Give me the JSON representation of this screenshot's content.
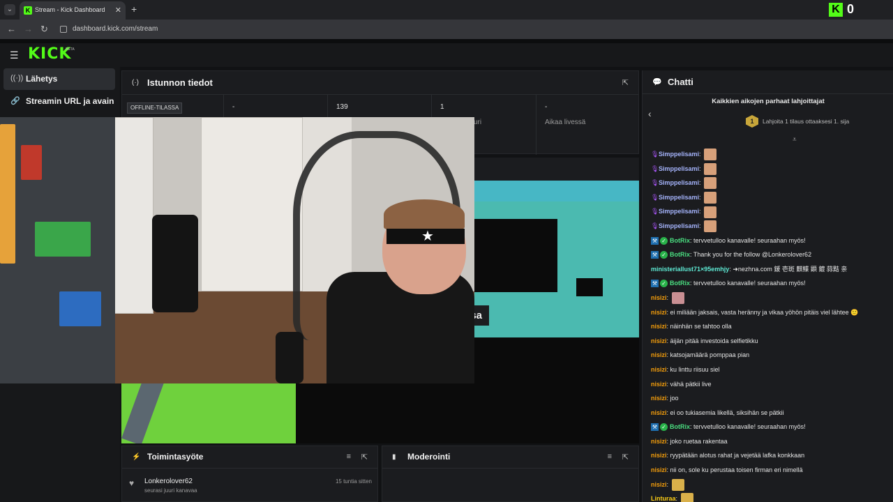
{
  "browser": {
    "tab_menu_icon": "chevron-down-icon",
    "tab_title": "Stream - Kick Dashboard",
    "tab_close": "✕",
    "new_tab": "+",
    "url": "dashboard.kick.com/stream",
    "kick_count": "0"
  },
  "header": {
    "logo": "KICK",
    "beta": "BETA"
  },
  "sidebar": {
    "items": [
      {
        "label": "Lähetys",
        "icon": "broadcast-icon",
        "active": true
      },
      {
        "label": "Streamin URL ja avain",
        "icon": "link-icon",
        "active": false
      }
    ]
  },
  "session": {
    "title": "Istunnon tiedot",
    "stats": [
      {
        "value": "OFFLINE-TILASSA",
        "label": ""
      },
      {
        "value": "-",
        "label": ""
      },
      {
        "value": "139",
        "label": ""
      },
      {
        "value": "1",
        "label": "uri"
      },
      {
        "value": "-",
        "label": "Aikaa livessä"
      }
    ]
  },
  "preview": {
    "label": "ssa"
  },
  "activity": {
    "title": "Toimintasyöte",
    "items": [
      {
        "user": "Lonkerolover62",
        "text": "seurasi juuri kanavaa",
        "time": "15 tuntia sitten"
      }
    ]
  },
  "moderation": {
    "title": "Moderointi"
  },
  "chat": {
    "title": "Chatti",
    "gifters_title": "Kaikkien aikojen parhaat lahjoittajat",
    "gifters_rank": "1",
    "gifters_text": "Lahjoita 1 tilaus ottaaksesi 1. sija",
    "colors": {
      "purple": "#a78bfa",
      "green": "#4ade80",
      "teal": "#5eead4",
      "orange": "#f59e0b",
      "gold": "#facc15"
    },
    "messages": [
      {
        "badge": "mic",
        "user": "Simppelisami",
        "color": "#a5b4fc",
        "text": "",
        "emote": "face"
      },
      {
        "badge": "mic",
        "user": "Simppelisami",
        "color": "#a5b4fc",
        "text": "",
        "emote": "face"
      },
      {
        "badge": "mic",
        "user": "Simppelisami",
        "color": "#a5b4fc",
        "text": "",
        "emote": "face"
      },
      {
        "badge": "mic",
        "user": "Simppelisami",
        "color": "#a5b4fc",
        "text": "",
        "emote": "face"
      },
      {
        "badge": "mic",
        "user": "Simppelisami",
        "color": "#a5b4fc",
        "text": "",
        "emote": "face"
      },
      {
        "badge": "mic",
        "user": "Simppelisami",
        "color": "#a5b4fc",
        "text": "",
        "emote": "face"
      },
      {
        "badge": "bot",
        "user": "BotRix",
        "color": "#4ade80",
        "text": "tervvetulloo kanavalle! seuraahan myös!",
        "emote": ""
      },
      {
        "badge": "bot",
        "user": "BotRix",
        "color": "#4ade80",
        "text": "Thank you for the follow @Lonkerolover62",
        "emote": ""
      },
      {
        "badge": "",
        "user": "ministeriallust71×95emhjy",
        "color": "#5eead4",
        "text": "➜nezhna.com 鍰 壱斑 麒鰈 顕 鍍 蒜黠 亲",
        "emote": ""
      },
      {
        "badge": "bot",
        "user": "BotRix",
        "color": "#4ade80",
        "text": "tervvetulloo kanavalle! seuraahan myös!",
        "emote": ""
      },
      {
        "badge": "",
        "user": "nisizi",
        "color": "#f59e0b",
        "text": "",
        "emote": "pink"
      },
      {
        "badge": "",
        "user": "nisizi",
        "color": "#f59e0b",
        "text": "ei miliään jaksais, vasta herännу ja vikaa yöhön pitäis viel lähtee 🙂",
        "emote": ""
      },
      {
        "badge": "",
        "user": "nisizi",
        "color": "#f59e0b",
        "text": "näinhän se tahtoo olla",
        "emote": ""
      },
      {
        "badge": "",
        "user": "nisizi",
        "color": "#f59e0b",
        "text": "äijän pitää investoida selfietikku",
        "emote": ""
      },
      {
        "badge": "",
        "user": "nisizi",
        "color": "#f59e0b",
        "text": "katsojamäärä pomppaa pian",
        "emote": ""
      },
      {
        "badge": "",
        "user": "nisizi",
        "color": "#f59e0b",
        "text": "ku linttu riisuu siel",
        "emote": ""
      },
      {
        "badge": "",
        "user": "nisizi",
        "color": "#f59e0b",
        "text": "vähä pätkii live",
        "emote": ""
      },
      {
        "badge": "",
        "user": "nisizi",
        "color": "#f59e0b",
        "text": "joo",
        "emote": ""
      },
      {
        "badge": "",
        "user": "nisizi",
        "color": "#f59e0b",
        "text": "ei oo tukiasemia likellä, siksihän se pätkii",
        "emote": ""
      },
      {
        "badge": "bot",
        "user": "BotRix",
        "color": "#4ade80",
        "text": "tervvetulloo kanavalle! seuraahan myös!",
        "emote": ""
      },
      {
        "badge": "",
        "user": "nisizi",
        "color": "#f59e0b",
        "text": "joko ruetaa rakentaa",
        "emote": ""
      },
      {
        "badge": "",
        "user": "nisizi",
        "color": "#f59e0b",
        "text": "ryypätään alotus rahat ja vejetää lafka konkkaan",
        "emote": ""
      },
      {
        "badge": "",
        "user": "nisizi",
        "color": "#f59e0b",
        "text": "nii on, sole ku perustaa toisen firman eri nimellä",
        "emote": ""
      },
      {
        "badge": "",
        "user": "nisizi",
        "color": "#f59e0b",
        "text": "",
        "emote": "gold"
      },
      {
        "badge": "",
        "user": "Linturaa",
        "color": "#facc15",
        "text": "",
        "emote": "gold"
      }
    ]
  }
}
